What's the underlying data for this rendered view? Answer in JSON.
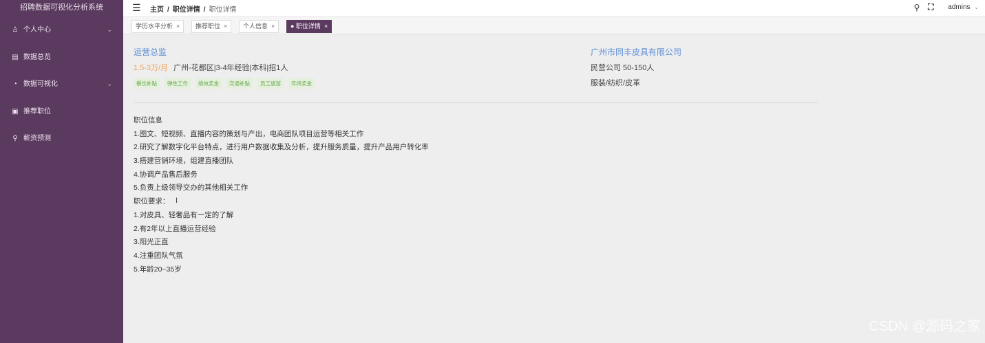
{
  "sidebar": {
    "brand": "招聘数据可视化分析系统",
    "items": [
      {
        "label": "个人中心",
        "icon": "user-icon",
        "glyph": "♙",
        "has_caret": true
      },
      {
        "label": "数据总览",
        "icon": "data-icon",
        "glyph": "▤",
        "has_caret": false
      },
      {
        "label": "数据可视化",
        "icon": "pie-chart-icon",
        "glyph": "◔",
        "has_caret": true
      },
      {
        "label": "推荐职位",
        "icon": "briefcase-icon",
        "glyph": "▣",
        "has_caret": false
      },
      {
        "label": "薪资预测",
        "icon": "search-icon",
        "glyph": "⚲",
        "has_caret": false
      }
    ]
  },
  "header": {
    "breadcrumb": {
      "home": "主页",
      "section": "职位详情",
      "current": "职位详情"
    },
    "user": "admins"
  },
  "tabs": [
    {
      "label": "学历水平分析",
      "active": false
    },
    {
      "label": "推荐职位",
      "active": false
    },
    {
      "label": "个人信息",
      "active": false
    },
    {
      "label": "● 职位详情",
      "active": true
    }
  ],
  "job": {
    "title": "运营总监",
    "salary": "1.5-3万/月",
    "meta": "广州-花都区|3-4年经验|本科|招1人",
    "tags": [
      "餐饮补贴",
      "弹性工作",
      "绩效奖金",
      "交通补贴",
      "员工旅游",
      "年终奖金"
    ]
  },
  "company": {
    "name": "广州市同丰皮具有限公司",
    "meta": "民营公司 50-150人",
    "industry": "服装/纺织/皮革"
  },
  "description": [
    "职位信息",
    "1.图文、短视频、直播内容的策划与产出，电商团队项目运营等相关工作",
    "2.研究了解数字化平台特点，进行用户数据收集及分析，提升服务质量，提升产品用户转化率",
    "3.搭建营销环境，组建直播团队",
    "4.协调产品售后服务",
    "5.负责上级领导交办的其他相关工作",
    "职位要求：",
    "1.对皮具、轻奢品有一定的了解",
    "2.有2年以上直播运营经验",
    "3.阳光正直",
    "4.注重团队气氛",
    "5.年龄20~35岁"
  ],
  "watermark": "CSDN @源码之家"
}
